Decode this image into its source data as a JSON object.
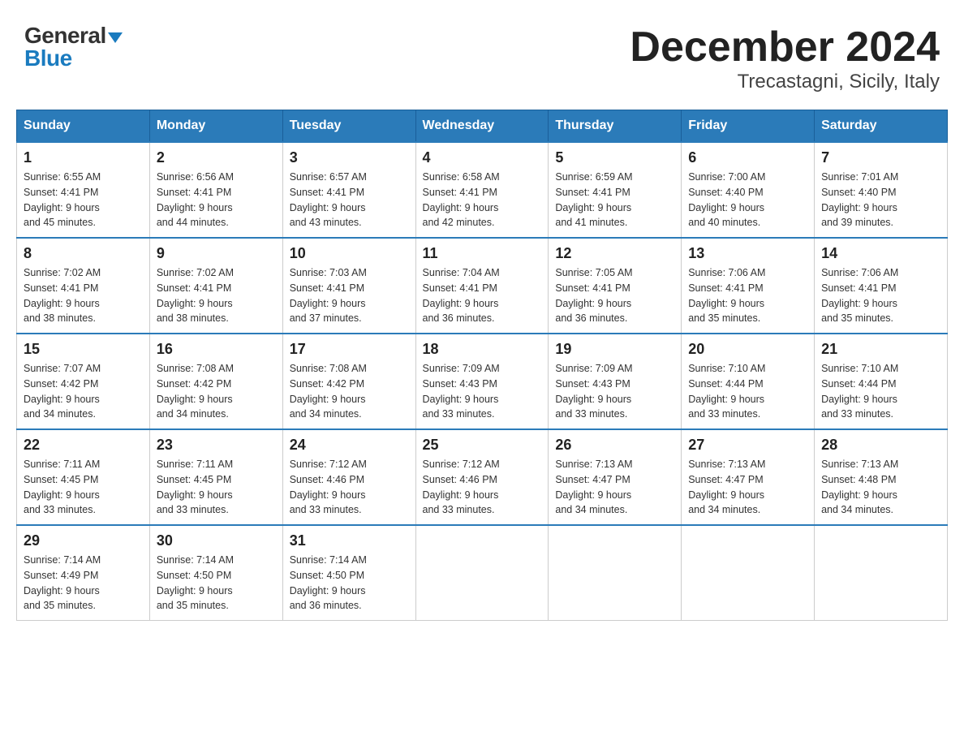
{
  "header": {
    "logo_general": "General",
    "logo_blue": "Blue",
    "month_title": "December 2024",
    "location": "Trecastagni, Sicily, Italy"
  },
  "days_of_week": [
    "Sunday",
    "Monday",
    "Tuesday",
    "Wednesday",
    "Thursday",
    "Friday",
    "Saturday"
  ],
  "weeks": [
    [
      {
        "day": "1",
        "sunrise": "6:55 AM",
        "sunset": "4:41 PM",
        "daylight": "9 hours and 45 minutes."
      },
      {
        "day": "2",
        "sunrise": "6:56 AM",
        "sunset": "4:41 PM",
        "daylight": "9 hours and 44 minutes."
      },
      {
        "day": "3",
        "sunrise": "6:57 AM",
        "sunset": "4:41 PM",
        "daylight": "9 hours and 43 minutes."
      },
      {
        "day": "4",
        "sunrise": "6:58 AM",
        "sunset": "4:41 PM",
        "daylight": "9 hours and 42 minutes."
      },
      {
        "day": "5",
        "sunrise": "6:59 AM",
        "sunset": "4:41 PM",
        "daylight": "9 hours and 41 minutes."
      },
      {
        "day": "6",
        "sunrise": "7:00 AM",
        "sunset": "4:40 PM",
        "daylight": "9 hours and 40 minutes."
      },
      {
        "day": "7",
        "sunrise": "7:01 AM",
        "sunset": "4:40 PM",
        "daylight": "9 hours and 39 minutes."
      }
    ],
    [
      {
        "day": "8",
        "sunrise": "7:02 AM",
        "sunset": "4:41 PM",
        "daylight": "9 hours and 38 minutes."
      },
      {
        "day": "9",
        "sunrise": "7:02 AM",
        "sunset": "4:41 PM",
        "daylight": "9 hours and 38 minutes."
      },
      {
        "day": "10",
        "sunrise": "7:03 AM",
        "sunset": "4:41 PM",
        "daylight": "9 hours and 37 minutes."
      },
      {
        "day": "11",
        "sunrise": "7:04 AM",
        "sunset": "4:41 PM",
        "daylight": "9 hours and 36 minutes."
      },
      {
        "day": "12",
        "sunrise": "7:05 AM",
        "sunset": "4:41 PM",
        "daylight": "9 hours and 36 minutes."
      },
      {
        "day": "13",
        "sunrise": "7:06 AM",
        "sunset": "4:41 PM",
        "daylight": "9 hours and 35 minutes."
      },
      {
        "day": "14",
        "sunrise": "7:06 AM",
        "sunset": "4:41 PM",
        "daylight": "9 hours and 35 minutes."
      }
    ],
    [
      {
        "day": "15",
        "sunrise": "7:07 AM",
        "sunset": "4:42 PM",
        "daylight": "9 hours and 34 minutes."
      },
      {
        "day": "16",
        "sunrise": "7:08 AM",
        "sunset": "4:42 PM",
        "daylight": "9 hours and 34 minutes."
      },
      {
        "day": "17",
        "sunrise": "7:08 AM",
        "sunset": "4:42 PM",
        "daylight": "9 hours and 34 minutes."
      },
      {
        "day": "18",
        "sunrise": "7:09 AM",
        "sunset": "4:43 PM",
        "daylight": "9 hours and 33 minutes."
      },
      {
        "day": "19",
        "sunrise": "7:09 AM",
        "sunset": "4:43 PM",
        "daylight": "9 hours and 33 minutes."
      },
      {
        "day": "20",
        "sunrise": "7:10 AM",
        "sunset": "4:44 PM",
        "daylight": "9 hours and 33 minutes."
      },
      {
        "day": "21",
        "sunrise": "7:10 AM",
        "sunset": "4:44 PM",
        "daylight": "9 hours and 33 minutes."
      }
    ],
    [
      {
        "day": "22",
        "sunrise": "7:11 AM",
        "sunset": "4:45 PM",
        "daylight": "9 hours and 33 minutes."
      },
      {
        "day": "23",
        "sunrise": "7:11 AM",
        "sunset": "4:45 PM",
        "daylight": "9 hours and 33 minutes."
      },
      {
        "day": "24",
        "sunrise": "7:12 AM",
        "sunset": "4:46 PM",
        "daylight": "9 hours and 33 minutes."
      },
      {
        "day": "25",
        "sunrise": "7:12 AM",
        "sunset": "4:46 PM",
        "daylight": "9 hours and 33 minutes."
      },
      {
        "day": "26",
        "sunrise": "7:13 AM",
        "sunset": "4:47 PM",
        "daylight": "9 hours and 34 minutes."
      },
      {
        "day": "27",
        "sunrise": "7:13 AM",
        "sunset": "4:47 PM",
        "daylight": "9 hours and 34 minutes."
      },
      {
        "day": "28",
        "sunrise": "7:13 AM",
        "sunset": "4:48 PM",
        "daylight": "9 hours and 34 minutes."
      }
    ],
    [
      {
        "day": "29",
        "sunrise": "7:14 AM",
        "sunset": "4:49 PM",
        "daylight": "9 hours and 35 minutes."
      },
      {
        "day": "30",
        "sunrise": "7:14 AM",
        "sunset": "4:50 PM",
        "daylight": "9 hours and 35 minutes."
      },
      {
        "day": "31",
        "sunrise": "7:14 AM",
        "sunset": "4:50 PM",
        "daylight": "9 hours and 36 minutes."
      },
      null,
      null,
      null,
      null
    ]
  ],
  "labels": {
    "sunrise": "Sunrise:",
    "sunset": "Sunset:",
    "daylight": "Daylight:"
  }
}
